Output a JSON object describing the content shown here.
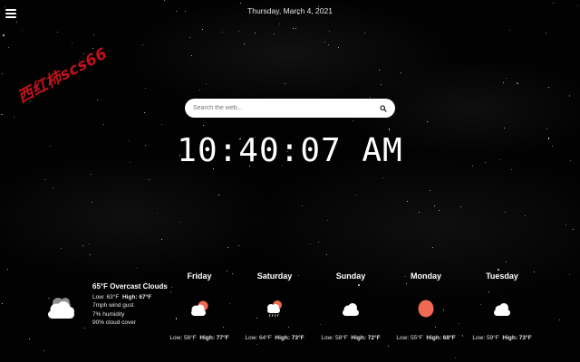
{
  "header": {
    "date": "Thursday, March 4, 2021"
  },
  "watermark": "西红柿scs66",
  "search": {
    "placeholder": "Search the web..."
  },
  "clock": {
    "time": "10:40:07 AM"
  },
  "current": {
    "condition": "65°F Overcast Clouds",
    "low_label": "Low:",
    "low": "63°F",
    "high_label": "High:",
    "high": "67°F",
    "wind": "7mph wind gust",
    "humidity": "7% humidity",
    "cloud_cover": "90% cloud cover",
    "icon": "cloud-icon"
  },
  "forecast": [
    {
      "day": "Friday",
      "icon": "cloud-sun-icon",
      "low_label": "Low:",
      "low": "58°F",
      "high_label": "High:",
      "high": "77°F"
    },
    {
      "day": "Saturday",
      "icon": "cloud-sun-rain-icon",
      "low_label": "Low:",
      "low": "64°F",
      "high_label": "High:",
      "high": "73°F"
    },
    {
      "day": "Sunday",
      "icon": "cloud-icon",
      "low_label": "Low:",
      "low": "58°F",
      "high_label": "High:",
      "high": "72°F"
    },
    {
      "day": "Monday",
      "icon": "sun-icon",
      "low_label": "Low:",
      "low": "55°F",
      "high_label": "High:",
      "high": "68°F"
    },
    {
      "day": "Tuesday",
      "icon": "cloud-icon",
      "low_label": "Low:",
      "low": "59°F",
      "high_label": "High:",
      "high": "73°F"
    }
  ],
  "colors": {
    "sun": "#ee6a52",
    "cloud": "#ffffff",
    "dark_cloud": "#bdbdbd",
    "watermark": "#c0121a",
    "background": "#000000"
  }
}
